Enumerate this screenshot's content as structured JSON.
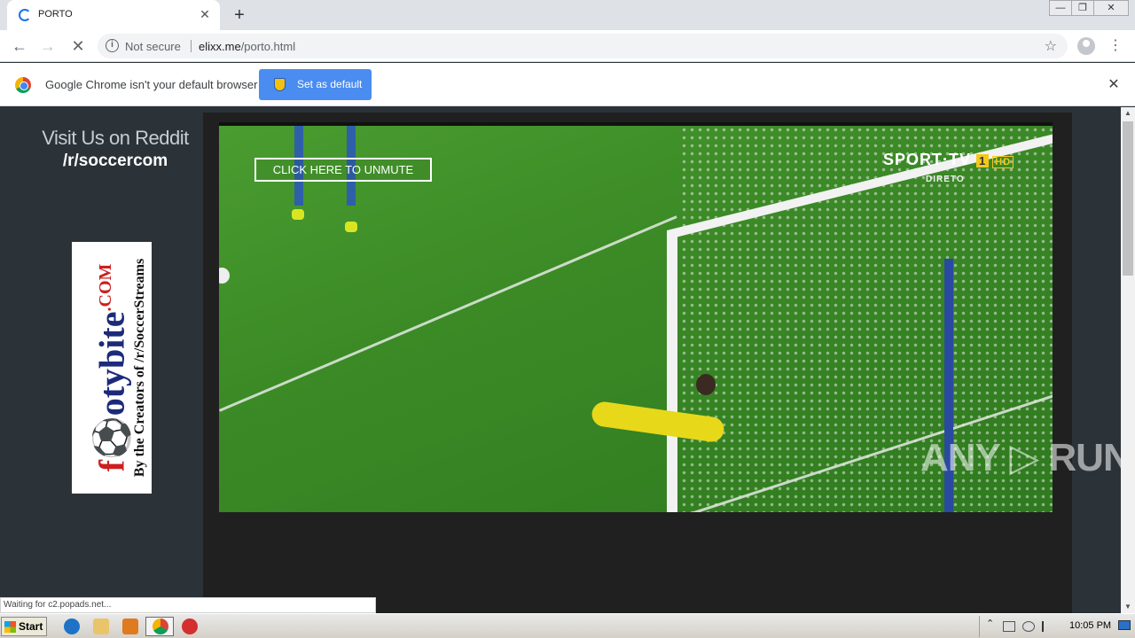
{
  "browser": {
    "tab_title": "PORTO",
    "tab_close": "✕",
    "new_tab": "+",
    "window_controls": {
      "minimize": "—",
      "restore": "❐",
      "close": "✕"
    },
    "security_label": "Not secure",
    "url_domain": "elixx.me",
    "url_path": "/porto.html",
    "infobar_message": "Google Chrome isn't your default browser",
    "set_default_label": "Set as default",
    "status_text": "Waiting for c2.popads.net..."
  },
  "page": {
    "reddit_line1": "Visit Us on Reddit",
    "reddit_line2": "/r/soccercom",
    "ad": {
      "brand_start": "f",
      "brand_mid": "⚽",
      "brand_rest": "otybite",
      "brand_tld": ".COM",
      "tagline": "By the Creators of /r/SoccerStreams"
    },
    "unmute_label": "CLICK HERE TO UNMUTE",
    "channel_logo": {
      "name": "SPORT·TV",
      "number": "1",
      "quality": "HD",
      "live_label": "DIRETO"
    },
    "watermark": "ANY ▷ RUN"
  },
  "taskbar": {
    "start_label": "Start",
    "clock": "10:05 PM"
  },
  "colors": {
    "page_bg": "#2c3338",
    "button_blue": "#4a8cf0",
    "pitch_green": "#3b8a26"
  }
}
